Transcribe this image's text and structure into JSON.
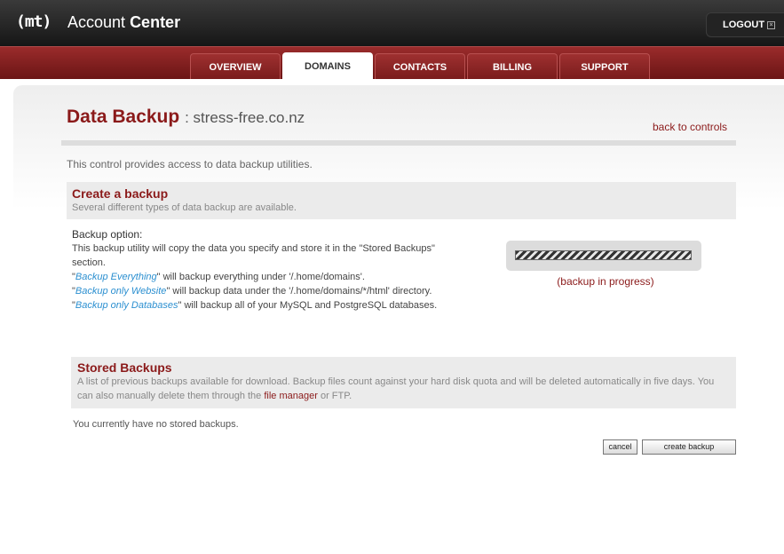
{
  "header": {
    "logo": "(mt)",
    "title_light": "Account",
    "title_bold": "Center",
    "logout_label": "LOGOUT"
  },
  "nav": {
    "tabs": [
      {
        "label": "OVERVIEW",
        "active": false
      },
      {
        "label": "DOMAINS",
        "active": true
      },
      {
        "label": "CONTACTS",
        "active": false
      },
      {
        "label": "BILLING",
        "active": false
      },
      {
        "label": "SUPPORT",
        "active": false
      }
    ]
  },
  "page": {
    "title": "Data Backup",
    "separator": ":",
    "domain": "stress-free.co.nz",
    "back_link": "back to controls",
    "intro": "This control provides access to data backup utilities."
  },
  "create_backup": {
    "title": "Create a backup",
    "description": "Several different types of data backup are available.",
    "option_label": "Backup option:",
    "line1": "This backup utility will copy the data you specify and store it in the \"Stored Backups\" section.",
    "everything_link": "Backup Everything",
    "everything_text": "\" will backup everything under '/.home/domains'.",
    "website_link": "Backup only Website",
    "website_text": "\" will backup data under the '/.home/domains/*/html' directory.",
    "databases_link": "Backup only Databases",
    "databases_text": "\" will backup all of your MySQL and PostgreSQL databases.",
    "progress_label": "(backup in progress)"
  },
  "stored_backups": {
    "title": "Stored Backups",
    "description_pre": "A list of previous backups available for download. Backup files count against your hard disk quota and will be deleted automatically in five days. You can also manually delete them through the ",
    "file_manager_link": "file manager",
    "description_post": " or FTP.",
    "empty_message": "You currently have no stored backups."
  },
  "buttons": {
    "cancel": "cancel",
    "create": "create backup"
  }
}
